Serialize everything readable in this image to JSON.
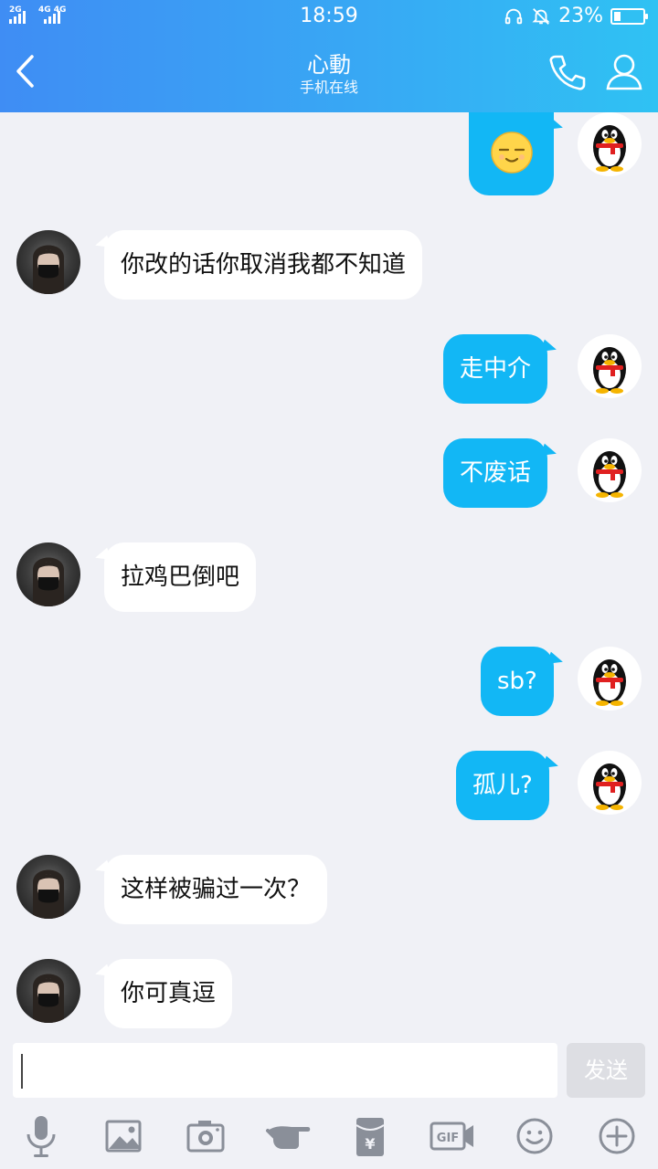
{
  "status_bar": {
    "signal_left": "2G",
    "signal_right": "4G 4G",
    "time": "18:59",
    "battery_percent": "23%",
    "battery_level": 0.23
  },
  "header": {
    "title": "心動",
    "subtitle": "手机在线"
  },
  "messages": [
    {
      "side": "right",
      "type": "emoji",
      "emoji": "sleepy-face-icon"
    },
    {
      "side": "left",
      "text": "你改的话你取消我都不知道"
    },
    {
      "side": "right",
      "text": "走中介"
    },
    {
      "side": "right",
      "text": "不废话"
    },
    {
      "side": "left",
      "text": "拉鸡巴倒吧"
    },
    {
      "side": "right",
      "text": "sb?"
    },
    {
      "side": "right",
      "text": "孤儿?"
    },
    {
      "side": "left",
      "text": "这样被骗过一次？"
    },
    {
      "side": "left",
      "text": "你可真逗"
    }
  ],
  "input": {
    "value": "",
    "send_label": "发送"
  },
  "toolbar": [
    {
      "name": "microphone-icon"
    },
    {
      "name": "image-icon"
    },
    {
      "name": "camera-icon"
    },
    {
      "name": "poke-icon"
    },
    {
      "name": "red-packet-icon"
    },
    {
      "name": "gif-icon"
    },
    {
      "name": "emoji-icon"
    },
    {
      "name": "plus-icon"
    }
  ],
  "colors": {
    "header_start": "#3f8df4",
    "header_end": "#2fc2f3",
    "bubble_out": "#12b7f5",
    "bubble_in": "#ffffff",
    "background": "#f0f1f6"
  }
}
